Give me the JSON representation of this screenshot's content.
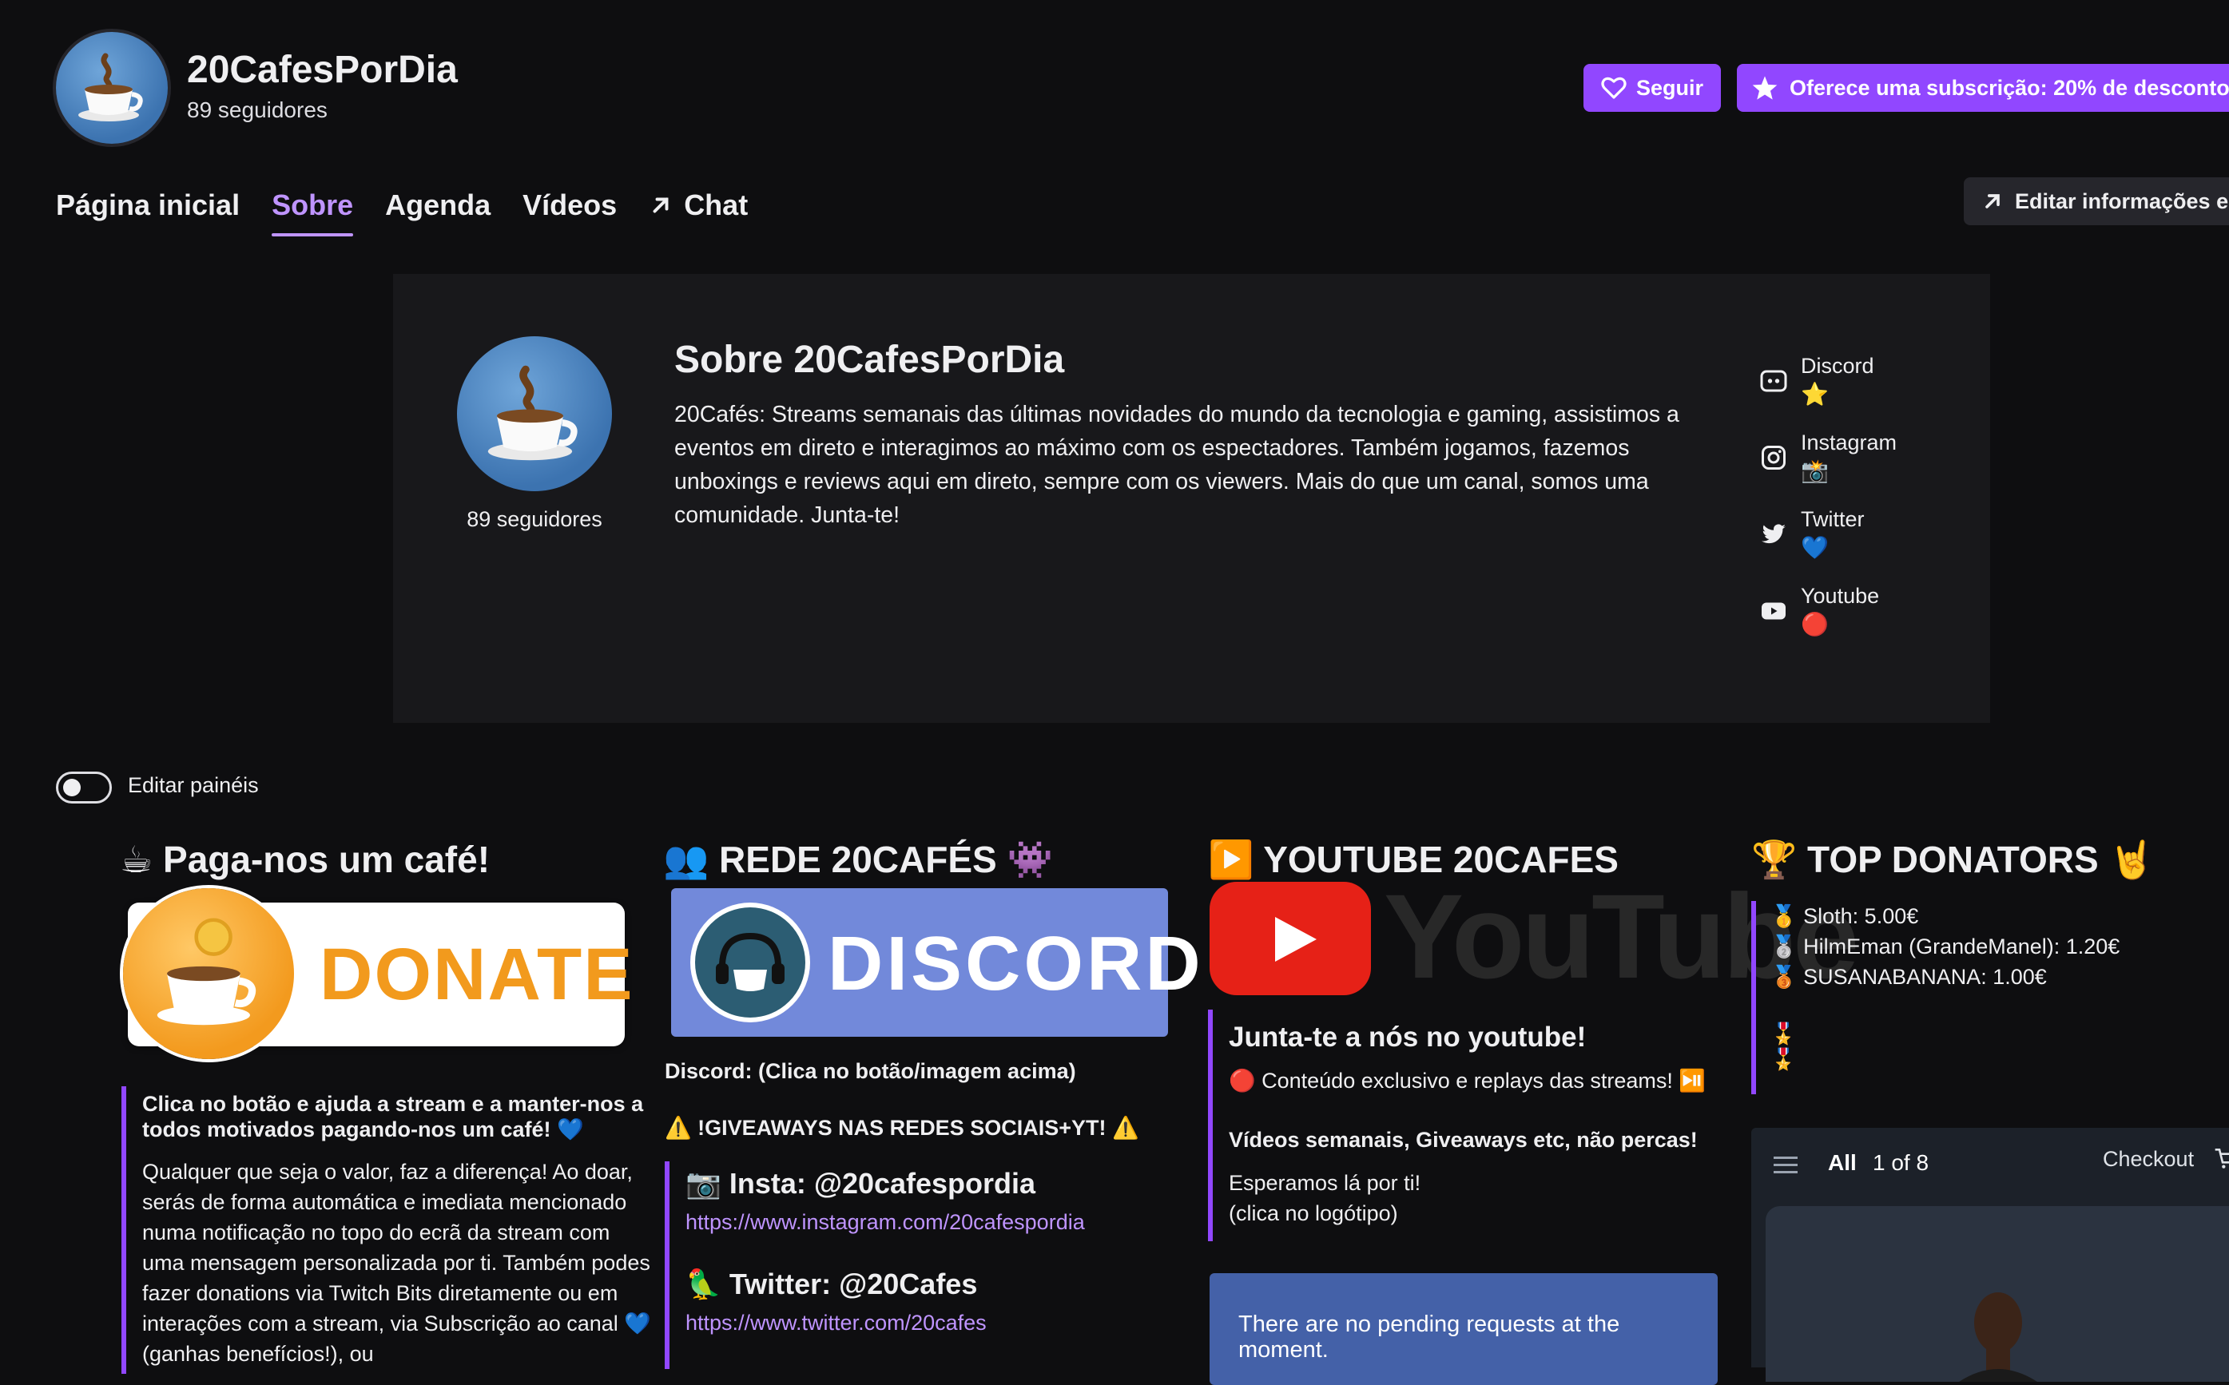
{
  "header": {
    "channel_name": "20CafesPorDia",
    "followers": "89 seguidores",
    "follow_label": "Seguir",
    "subscribe_label": "Oferece uma subscrição: 20% de desconto"
  },
  "tabs": [
    {
      "label": "Página inicial"
    },
    {
      "label": "Sobre"
    },
    {
      "label": "Agenda"
    },
    {
      "label": "Vídeos"
    },
    {
      "label": "Chat"
    }
  ],
  "edit_info_label": "Editar informações e",
  "about": {
    "title": "Sobre 20CafesPorDia",
    "followers": "89 seguidores",
    "description": "20Cafés: Streams semanais das últimas novidades do mundo da tecnologia e gaming, assistimos a eventos em direto e interagimos ao máximo com os espectadores. Também jogamos, fazemos unboxings e reviews aqui em direto, sempre com os viewers. Mais do que um canal, somos uma comunidade. Junta-te!",
    "social": [
      {
        "name": "Discord",
        "emoji": "⭐",
        "icon": "discord-icon"
      },
      {
        "name": "Instagram",
        "emoji": "📸",
        "icon": "instagram-icon"
      },
      {
        "name": "Twitter",
        "emoji": "💙",
        "icon": "twitter-icon"
      },
      {
        "name": "Youtube",
        "emoji": "🔴",
        "icon": "youtube-icon"
      }
    ]
  },
  "edit_panels_label": "Editar painéis",
  "panels": {
    "donate": {
      "title": "☕ Paga-nos um café!",
      "image_text": "DONATE",
      "bold_text": "Clica no botão e ajuda a stream e a manter-nos a todos motivados pagando-nos um café! 💙",
      "body": "Qualquer que seja o valor, faz a diferença! Ao doar, serás de forma automática e imediata mencionado numa notificação no topo do ecrã da stream com uma mensagem personalizada por ti. Também podes fazer donations via Twitch Bits diretamente ou em interações com a stream, via Subscrição ao canal 💙 (ganhas benefícios!), ou"
    },
    "rede": {
      "title": "👥 REDE 20CAFÉS 👾",
      "image_text": "DISCORD",
      "discord_caption": "Discord: (Clica no botão/imagem acima)",
      "giveaways": "⚠️ !GIVEAWAYS NAS REDES SOCIAIS+YT! ⚠️",
      "insta_title": "📷 Insta: @20cafespordia",
      "insta_link": "https://www.instagram.com/20cafespordia",
      "twitter_title": "🦜 Twitter: @20Cafes",
      "twitter_link": "https://www.twitter.com/20cafes"
    },
    "youtube": {
      "title": "▶️ YOUTUBE 20CAFES",
      "image_text": "YouTube",
      "heading": "Junta-te a nós no youtube!",
      "line1": "🔴 Conteúdo exclusivo e replays das streams! ⏯️",
      "bold_line": "Vídeos semanais, Giveaways etc, não percas!",
      "line2": "Esperamos lá por ti!",
      "line3": "(clica no logótipo)",
      "pending": "There are no pending requests at the moment."
    },
    "donators": {
      "title": "🏆 TOP DONATORS 🤘",
      "list": [
        {
          "medal": "🥇",
          "text": "Sloth: 5.00€"
        },
        {
          "medal": "🥈",
          "text": "HilmEman (GrandeManel): 1.20€"
        },
        {
          "medal": "🥉",
          "text": "SUSANABANANA: 1.00€"
        }
      ],
      "ribbons": "🎖️"
    },
    "shop": {
      "filter": "All",
      "pager": "1 of 8",
      "checkout": "Checkout"
    }
  }
}
